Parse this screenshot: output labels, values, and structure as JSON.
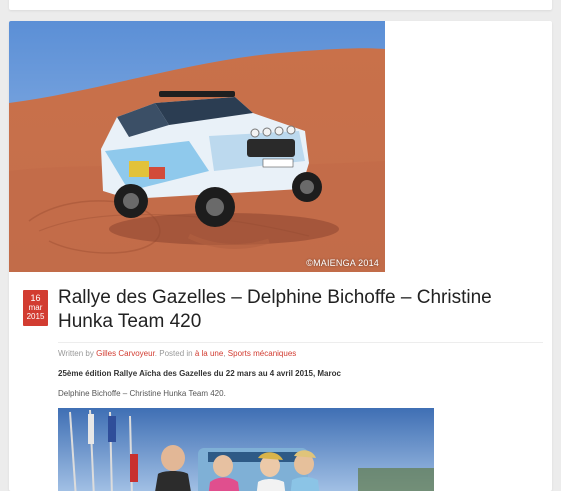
{
  "post": {
    "featured_image_alt": "Rally car in the desert dunes",
    "photo_credit": "©MAIENGA 2014",
    "date": {
      "day": "16",
      "month": "mar",
      "year": "2015"
    },
    "title": "Rallye des Gazelles – Delphine Bichoffe – Christine Hunka Team 420",
    "meta": {
      "written_by": "Written by",
      "author": "Gilles Carvoyeur",
      "posted_in": ". Posted in",
      "category_1": "à la une",
      "separator": ",",
      "category_2": "Sports mécaniques"
    },
    "subtitle": "25ème édition Rallye Aïcha des Gazelles du 22 mars au 4 avril 2015, Maroc",
    "body": "Delphine Bichoffe – Christine Hunka Team 420."
  },
  "colors": {
    "accent": "#d23c31",
    "background": "#ececec",
    "card": "#ffffff"
  }
}
